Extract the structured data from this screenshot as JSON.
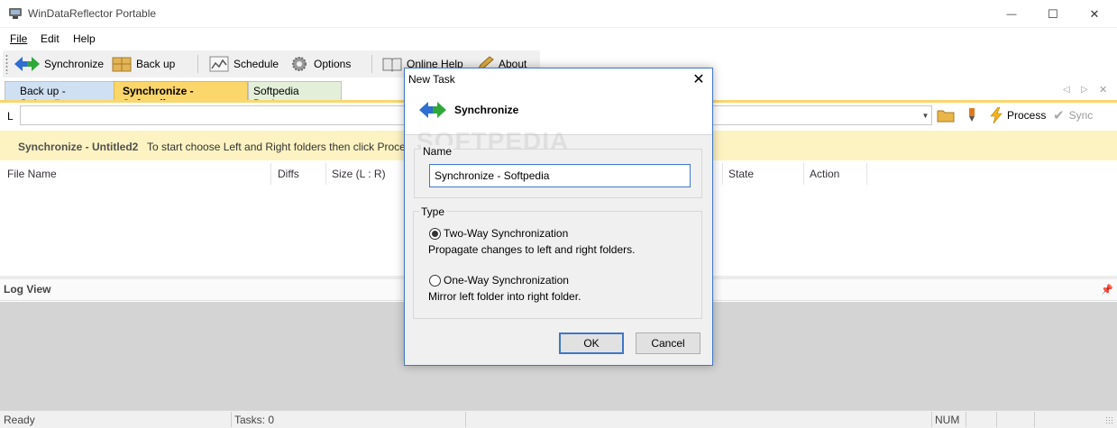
{
  "window": {
    "title": "WinDataReflector Portable",
    "controls": {
      "minimize": "—",
      "maximize": "☐",
      "close": "✕"
    }
  },
  "menu": {
    "file": "File",
    "edit": "Edit",
    "help": "Help"
  },
  "toolbar": {
    "synchronize": "Synchronize",
    "backup": "Back up",
    "schedule": "Schedule",
    "options": "Options",
    "online_help": "Online Help",
    "about": "About"
  },
  "tabs": [
    {
      "label": "Back up - Softpedia"
    },
    {
      "label": "Synchronize - Softpedia"
    },
    {
      "label": "Softpedia Backup"
    }
  ],
  "path_row": {
    "left_label": "L",
    "value": "",
    "process": "Process",
    "sync": "Sync"
  },
  "info": {
    "title": "Synchronize - Untitled2",
    "text": "To start choose Left and Right folders then click Proces"
  },
  "grid": {
    "columns": [
      "File Name",
      "Diffs",
      "Size (L : R)",
      "State",
      "Action"
    ]
  },
  "log": {
    "title": "Log View"
  },
  "status": {
    "ready": "Ready",
    "tasks": "Tasks: 0",
    "num": "NUM"
  },
  "dialog": {
    "title": "New Task",
    "header": "Synchronize",
    "name_label": "Name",
    "name_value": "Synchronize - Softpedia",
    "type_label": "Type",
    "options": [
      {
        "label": "Two-Way Synchronization",
        "desc": "Propagate changes to left and right folders.",
        "selected": true
      },
      {
        "label": "One-Way Synchronization",
        "desc": "Mirror left folder into right folder.",
        "selected": false
      }
    ],
    "ok": "OK",
    "cancel": "Cancel",
    "watermark": "SOFTPEDIA"
  },
  "colors": {
    "tab_active": "#fbd66a",
    "tab_first": "#cfe0f3",
    "tab_third": "#e3efd9",
    "info_bg": "#fdf3c2",
    "accent": "#3e77c5"
  }
}
